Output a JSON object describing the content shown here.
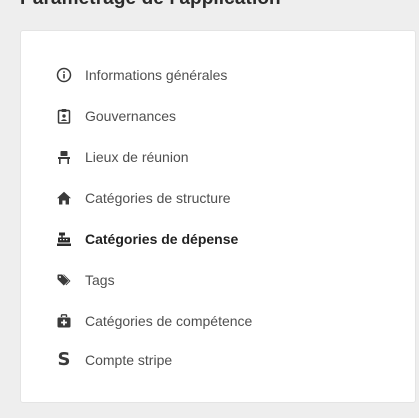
{
  "page": {
    "title": "Paramétrage de l'application"
  },
  "colors": {
    "icon": "#3a3a3a",
    "text": "#4f4f4f",
    "active_text": "#222222",
    "card_bg": "#ffffff",
    "page_bg": "#eeeeee"
  },
  "menu": {
    "items": [
      {
        "label": "Informations générales",
        "icon": "info-circle-icon",
        "active": false
      },
      {
        "label": "Gouvernances",
        "icon": "clipboard-user-icon",
        "active": false
      },
      {
        "label": "Lieux de réunion",
        "icon": "desk-chair-icon",
        "active": false
      },
      {
        "label": "Catégories de structure",
        "icon": "home-icon",
        "active": false
      },
      {
        "label": "Catégories de dépense",
        "icon": "cash-register-icon",
        "active": true
      },
      {
        "label": "Tags",
        "icon": "tags-icon",
        "active": false
      },
      {
        "label": "Catégories de compétence",
        "icon": "medkit-icon",
        "active": false
      },
      {
        "label": "Compte stripe",
        "icon": "stripe-s-icon",
        "active": false
      }
    ]
  },
  "stripe_icon_glyph": "S"
}
